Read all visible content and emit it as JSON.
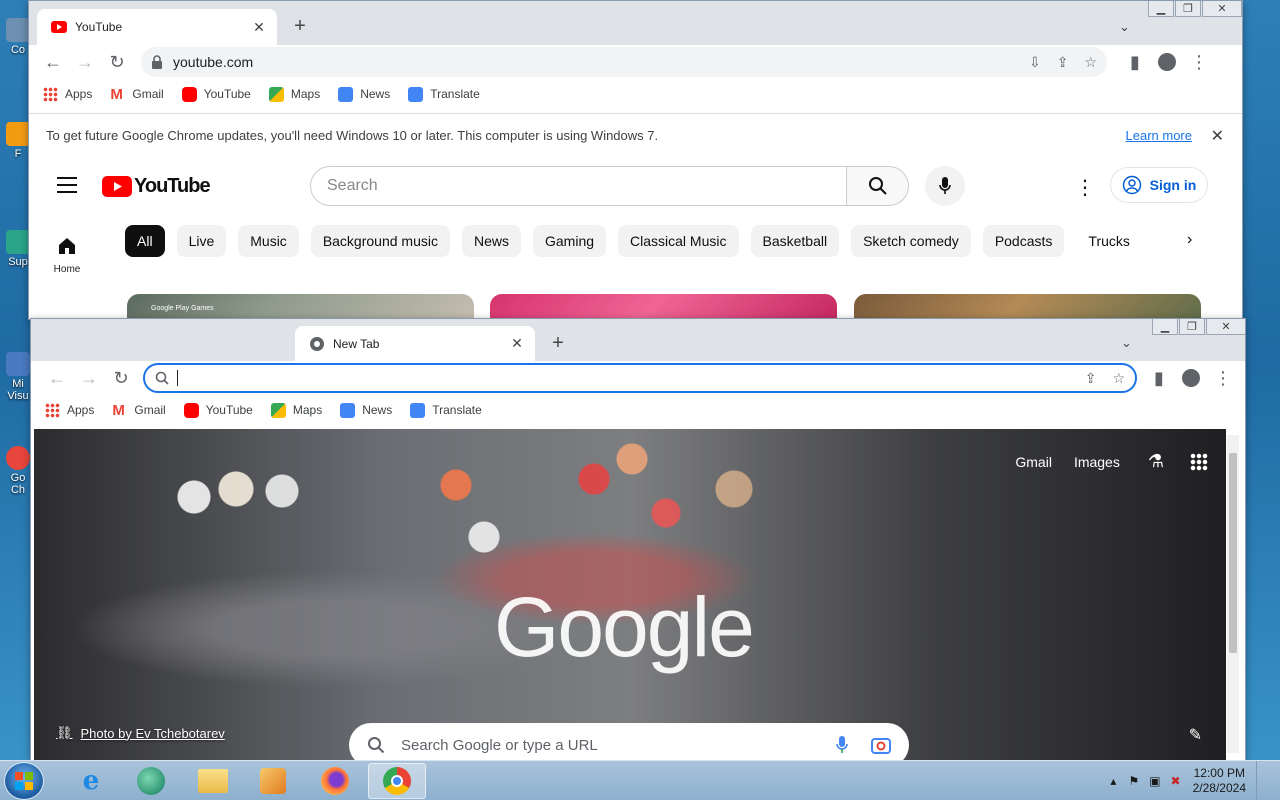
{
  "desktop": {
    "icons": [
      {
        "label": "Co",
        "color": "#6d8fb0"
      },
      {
        "label": "F",
        "color": "#f39c12"
      },
      {
        "label": "Sup",
        "color": "#2aa58a"
      },
      {
        "label": "Mi Visu",
        "color": "#4a79c2"
      },
      {
        "label": "Go Ch",
        "color": "#e8453c"
      }
    ]
  },
  "window_back": {
    "tab": {
      "title": "YouTube"
    },
    "address": "youtube.com",
    "bookmarks": [
      "Apps",
      "Gmail",
      "YouTube",
      "Maps",
      "News",
      "Translate"
    ],
    "infobar": {
      "message": "To get future Google Chrome updates, you'll need Windows 10 or later. This computer is using Windows 7.",
      "link": "Learn more"
    },
    "youtube": {
      "logo_text": "YouTube",
      "search_placeholder": "Search",
      "sign_in": "Sign in",
      "home_label": "Home",
      "chips": [
        "All",
        "Live",
        "Music",
        "Background music",
        "News",
        "Gaming",
        "Classical Music",
        "Basketball",
        "Sketch comedy",
        "Podcasts",
        "Trucks"
      ],
      "thumb_badge": "Google Play Games"
    }
  },
  "window_front": {
    "tab": {
      "title": "New Tab"
    },
    "address": "",
    "bookmarks": [
      "Apps",
      "Gmail",
      "YouTube",
      "Maps",
      "News",
      "Translate"
    ],
    "ntp": {
      "gmail": "Gmail",
      "images": "Images",
      "logo": "Google",
      "search_placeholder": "Search Google or type a URL",
      "photo_credit": "Photo by Ev Tchebotarev"
    }
  },
  "taskbar": {
    "time": "12:00 PM",
    "date": "2/28/2024"
  },
  "colors": {
    "chrome_blue": "#1a73e8",
    "youtube_red": "#ff0000",
    "tabstrip": "#dfe3e8"
  }
}
